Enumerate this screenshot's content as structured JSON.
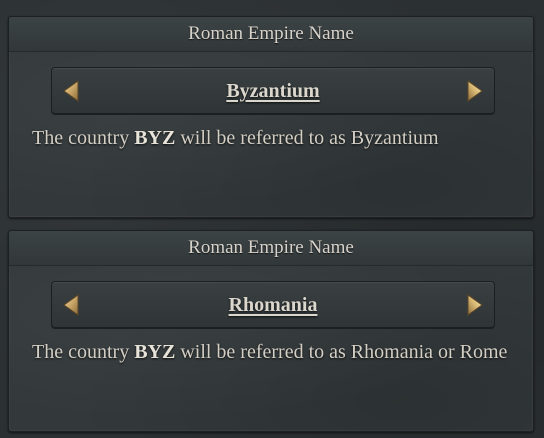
{
  "panels": [
    {
      "title": "Roman Empire Name",
      "selected_name": "Byzantium",
      "description_prefix": "The country ",
      "country_tag": "BYZ",
      "description_suffix": " will be referred to as Byzantium",
      "prev_icon": "triangle-left-icon",
      "next_icon": "triangle-right-icon"
    },
    {
      "title": "Roman Empire Name",
      "selected_name": "Rhomania",
      "description_prefix": "The country ",
      "country_tag": "BYZ",
      "description_suffix": " will be referred to as Rhomania or Rome",
      "prev_icon": "triangle-left-icon",
      "next_icon": "triangle-right-icon"
    }
  ],
  "colors": {
    "arrow_gold": "#c9a567",
    "arrow_highlight": "#f1dca4",
    "text": "#d4cfc5"
  }
}
